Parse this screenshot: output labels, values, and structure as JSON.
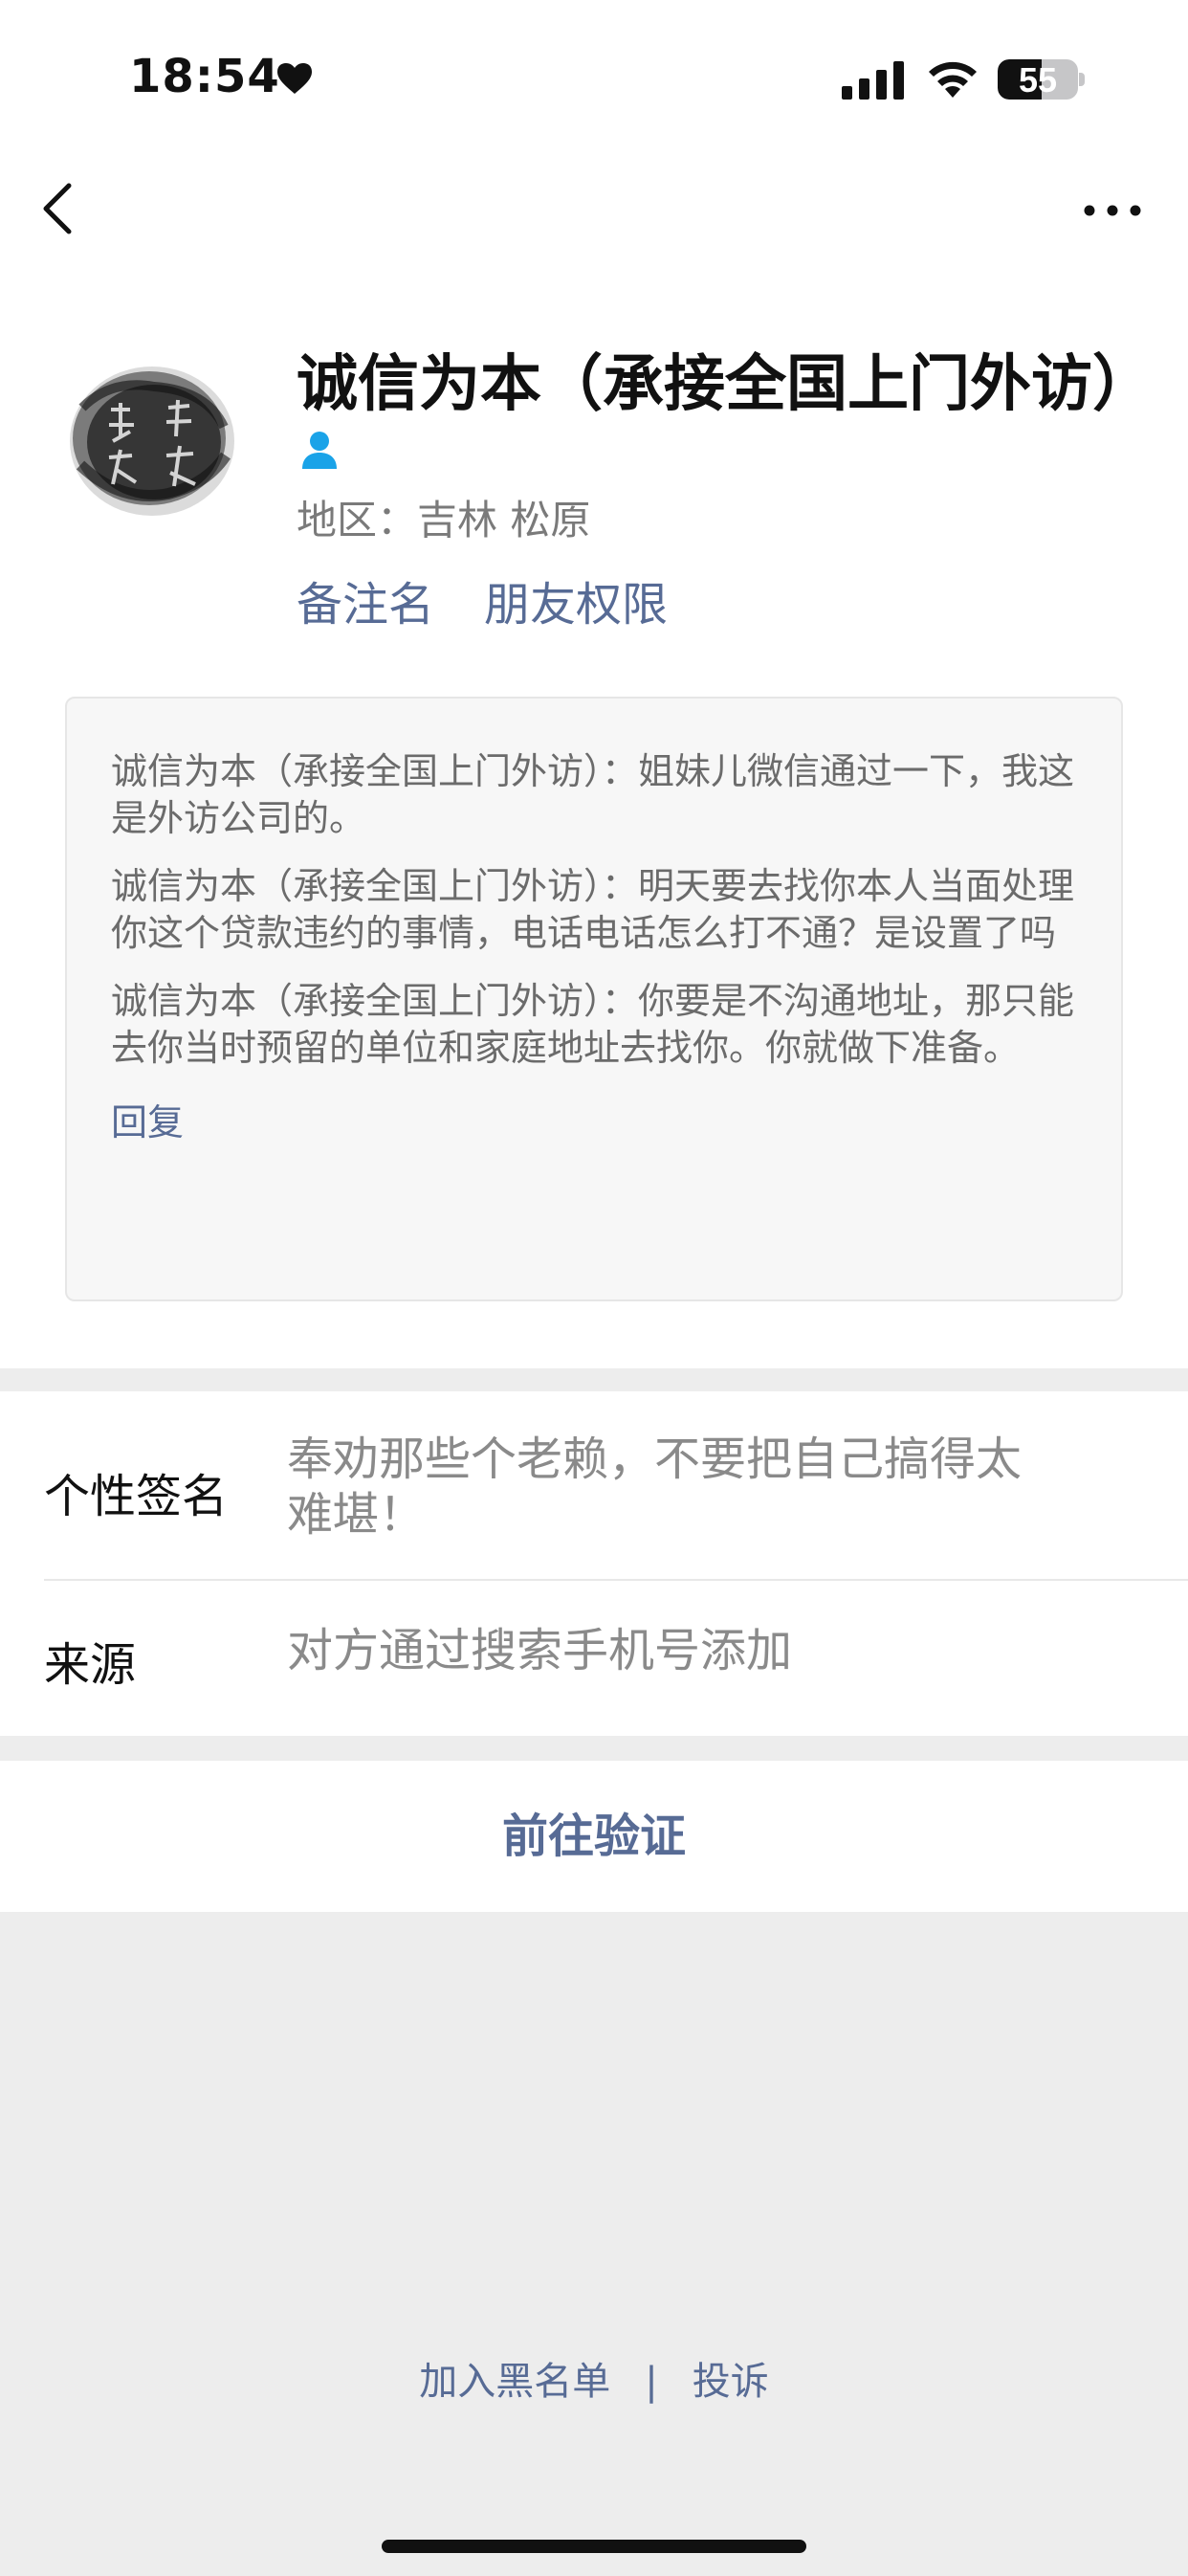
{
  "status_bar": {
    "time": "18:54",
    "battery_level": "55",
    "battery_fraction": 0.55
  },
  "nav": {
    "back_icon": "chevron-left-icon",
    "more_icon": "more-dots-icon"
  },
  "profile": {
    "name": "诚信为本（承接全国上门外访）",
    "region": "地区：吉林 松原",
    "remark_link": "备注名",
    "permission_link": "朋友权限",
    "gender_icon": "person-icon",
    "gender_color": "#1aa3e8"
  },
  "messages": {
    "items": [
      "诚信为本（承接全国上门外访）：姐妹儿微信通过一下，我这是外访公司的。",
      "诚信为本（承接全国上门外访）：明天要去找你本人当面处理你这个贷款违约的事情，电话电话怎么打不通？是设置了吗",
      "诚信为本（承接全国上门外访）：你要是不沟通地址，那只能去你当时预留的单位和家庭地址去找你。你就做下准备。"
    ],
    "reply": "回复"
  },
  "info": {
    "signature_label": "个性签名",
    "signature_value": "奉劝那些个老赖，不要把自己搞得太难堪！",
    "source_label": "来源",
    "source_value": "对方通过搜索手机号添加"
  },
  "verify_button": "前往验证",
  "footer": {
    "blacklist": "加入黑名单",
    "separator": "|",
    "complain": "投诉"
  },
  "colors": {
    "link": "#576b95",
    "background": "#ededed"
  }
}
